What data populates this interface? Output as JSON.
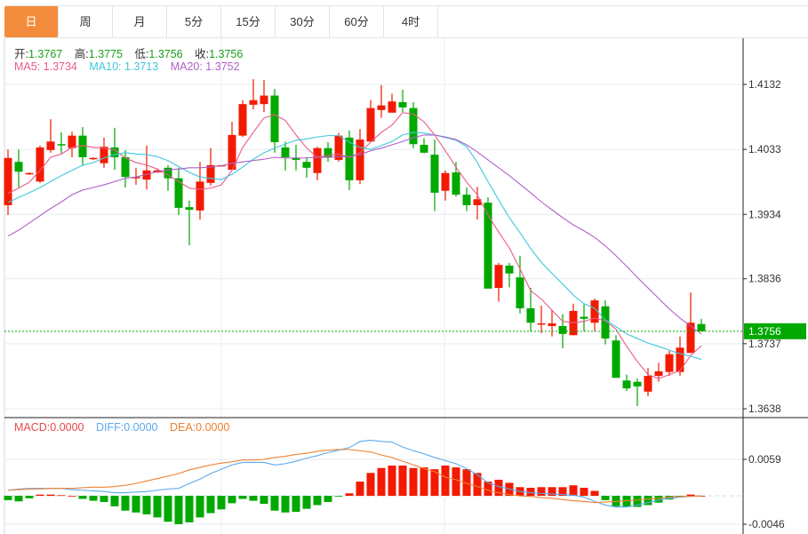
{
  "tabs": [
    {
      "label": "日",
      "active": true
    },
    {
      "label": "周"
    },
    {
      "label": "月"
    },
    {
      "label": "5分"
    },
    {
      "label": "15分"
    },
    {
      "label": "30分"
    },
    {
      "label": "60分"
    },
    {
      "label": "4时"
    }
  ],
  "ohlc_legend": {
    "open_label": "开:",
    "open": "1.3767",
    "high_label": "高:",
    "high": "1.3775",
    "low_label": "低:",
    "low": "1.3756",
    "close_label": "收:",
    "close": "1.3756"
  },
  "ma_legend": {
    "ma5": "MA5: 1.3734",
    "ma10": "MA10: 1.3713",
    "ma20": "MA20: 1.3752"
  },
  "macd_legend": {
    "macd": "MACD:0.0000",
    "diff": "DIFF:0.0000",
    "dea": "DEA:0.0000"
  },
  "colors": {
    "up": "#f21a00",
    "down": "#00a800",
    "ma5": "#ea5a8c",
    "ma10": "#3ec8dc",
    "ma20": "#b060c8",
    "diff": "#5aaaf0",
    "dea": "#f08030",
    "active_tab": "#f28c3c",
    "last_price": "#00a800"
  },
  "chart_data": [
    {
      "type": "candlestick",
      "price_ticks": [
        "1.4132",
        "1.4033",
        "1.3934",
        "1.3836",
        "1.3737",
        "1.3638"
      ],
      "ylim": [
        1.3638,
        1.4132
      ],
      "last_price": "1.3756",
      "grid": true,
      "candles": [
        [
          1.3948,
          1.4033,
          1.3933,
          1.402
        ],
        [
          1.4014,
          1.4033,
          1.3975,
          1.3999
        ],
        [
          1.3995,
          1.3998,
          1.3994,
          1.3997
        ],
        [
          1.3984,
          1.4039,
          1.3982,
          1.4036
        ],
        [
          1.4032,
          1.4079,
          1.4028,
          1.4045
        ],
        [
          1.4041,
          1.4059,
          1.4027,
          1.404
        ],
        [
          1.4035,
          1.406,
          1.4021,
          1.4054
        ],
        [
          1.4054,
          1.4067,
          1.4008,
          1.4021
        ],
        [
          1.4018,
          1.4021,
          1.4017,
          1.402
        ],
        [
          1.4012,
          1.4051,
          1.4005,
          1.4037
        ],
        [
          1.4036,
          1.4066,
          1.4002,
          1.4021
        ],
        [
          1.4021,
          1.4032,
          1.3975,
          1.3991
        ],
        [
          1.399,
          1.4005,
          1.3979,
          1.3991
        ],
        [
          1.3987,
          1.4039,
          1.3972,
          1.4001
        ],
        [
          1.3998,
          1.4004,
          1.3997,
          1.4001
        ],
        [
          1.4005,
          1.4009,
          1.397,
          1.3989
        ],
        [
          1.3989,
          1.4005,
          1.3933,
          1.3944
        ],
        [
          1.3945,
          1.3955,
          1.3887,
          1.3941
        ],
        [
          1.394,
          1.4014,
          1.3926,
          1.3984
        ],
        [
          1.3982,
          1.4035,
          1.3978,
          1.4009
        ],
        [
          1.4008,
          1.4009,
          1.4008,
          1.4009
        ],
        [
          1.4002,
          1.4075,
          1.4001,
          1.4055
        ],
        [
          1.4054,
          1.4108,
          1.4052,
          1.4102
        ],
        [
          1.4101,
          1.414,
          1.4094,
          1.4108
        ],
        [
          1.4102,
          1.4139,
          1.409,
          1.4115
        ],
        [
          1.4115,
          1.4125,
          1.4028,
          1.4044
        ],
        [
          1.4036,
          1.4045,
          1.4001,
          1.4021
        ],
        [
          1.402,
          1.404,
          1.4001,
          1.4017
        ],
        [
          1.4014,
          1.4021,
          1.399,
          1.4005
        ],
        [
          1.3997,
          1.4037,
          1.3986,
          1.4035
        ],
        [
          1.4035,
          1.4044,
          1.4014,
          1.4021
        ],
        [
          1.4017,
          1.4058,
          1.4014,
          1.4054
        ],
        [
          1.4051,
          1.4062,
          1.3971,
          1.3986
        ],
        [
          1.3986,
          1.4064,
          1.398,
          1.4048
        ],
        [
          1.4045,
          1.4108,
          1.4044,
          1.4096
        ],
        [
          1.4093,
          1.4131,
          1.4081,
          1.41
        ],
        [
          1.4089,
          1.4118,
          1.4089,
          1.4106
        ],
        [
          1.4105,
          1.4124,
          1.409,
          1.4097
        ],
        [
          1.4096,
          1.4105,
          1.4035,
          1.4041
        ],
        [
          1.404,
          1.405,
          1.4027,
          1.4028
        ],
        [
          1.4025,
          1.4048,
          1.3939,
          1.3967
        ],
        [
          1.397,
          1.4001,
          1.3955,
          1.3997
        ],
        [
          1.3998,
          1.4014,
          1.3961,
          1.3964
        ],
        [
          1.3964,
          1.3975,
          1.3939,
          1.3948
        ],
        [
          1.3948,
          1.3976,
          1.3926,
          1.3957
        ],
        [
          1.3952,
          1.396,
          1.3821,
          1.3821
        ],
        [
          1.3822,
          1.386,
          1.3801,
          1.3857
        ],
        [
          1.3856,
          1.386,
          1.3823,
          1.3844
        ],
        [
          1.3838,
          1.3871,
          1.3783,
          1.3791
        ],
        [
          1.3791,
          1.3822,
          1.3756,
          1.3769
        ],
        [
          1.3767,
          1.3795,
          1.3753,
          1.3768
        ],
        [
          1.3764,
          1.3788,
          1.3748,
          1.3768
        ],
        [
          1.3764,
          1.3782,
          1.373,
          1.3752
        ],
        [
          1.375,
          1.3798,
          1.375,
          1.3787
        ],
        [
          1.3778,
          1.3797,
          1.3756,
          1.3775
        ],
        [
          1.3769,
          1.3806,
          1.3756,
          1.3803
        ],
        [
          1.3794,
          1.3803,
          1.3736,
          1.3745
        ],
        [
          1.3742,
          1.375,
          1.3685,
          1.3685
        ],
        [
          1.3681,
          1.369,
          1.3665,
          1.3669
        ],
        [
          1.3679,
          1.3684,
          1.3642,
          1.3672
        ],
        [
          1.3664,
          1.37,
          1.3657,
          1.3688
        ],
        [
          1.3688,
          1.3708,
          1.3679,
          1.3695
        ],
        [
          1.3694,
          1.3726,
          1.3688,
          1.3721
        ],
        [
          1.3694,
          1.3748,
          1.3688,
          1.3731
        ],
        [
          1.3723,
          1.3815,
          1.3723,
          1.3769
        ],
        [
          1.3767,
          1.3775,
          1.3756,
          1.3756
        ]
      ],
      "ma5": [
        1.3966,
        1.3974,
        1.3983,
        1.4001,
        1.4021,
        1.4026,
        1.4036,
        1.4039,
        1.4036,
        1.4035,
        1.4032,
        1.402,
        1.4013,
        1.4009,
        1.4003,
        1.3994,
        1.3984,
        1.3974,
        1.3972,
        1.3974,
        1.3979,
        1.4001,
        1.4036,
        1.4059,
        1.4081,
        1.4086,
        1.4077,
        1.4055,
        1.4035,
        1.4021,
        1.4024,
        1.4026,
        1.4021,
        1.4028,
        1.4044,
        1.4059,
        1.407,
        1.4089,
        1.4087,
        1.4075,
        1.4055,
        1.4031,
        1.4006,
        1.3983,
        1.3964,
        1.3933,
        1.3907,
        1.3883,
        1.3851,
        1.3818,
        1.3805,
        1.3788,
        1.3771,
        1.3769,
        1.3771,
        1.3776,
        1.3772,
        1.3759,
        1.3733,
        1.371,
        1.369,
        1.3684,
        1.369,
        1.3696,
        1.3719,
        1.3734
      ],
      "ma10": [
        1.3952,
        1.396,
        1.3967,
        1.3975,
        1.3984,
        1.3993,
        1.4001,
        1.4009,
        1.4013,
        1.402,
        1.4025,
        1.4028,
        1.4026,
        1.4025,
        1.4022,
        1.4016,
        1.4007,
        1.3998,
        1.3991,
        1.3989,
        1.3987,
        1.3995,
        1.4006,
        1.4018,
        1.4028,
        1.4035,
        1.4041,
        1.4047,
        1.4049,
        1.4052,
        1.4054,
        1.4054,
        1.4044,
        1.4036,
        1.4033,
        1.4039,
        1.4045,
        1.4055,
        1.4059,
        1.4058,
        1.4055,
        1.4051,
        1.4047,
        1.4037,
        1.4013,
        1.3984,
        1.3956,
        1.3929,
        1.3906,
        1.3882,
        1.3861,
        1.3844,
        1.3828,
        1.3811,
        1.3798,
        1.3791,
        1.3773,
        1.3763,
        1.3752,
        1.3745,
        1.3738,
        1.3733,
        1.3727,
        1.3722,
        1.3718,
        1.3713
      ],
      "ma20": [
        1.3901,
        1.391,
        1.3921,
        1.3932,
        1.3943,
        1.3953,
        1.3964,
        1.3971,
        1.3975,
        1.3979,
        1.3984,
        1.3989,
        1.3991,
        1.3995,
        1.3999,
        1.4002,
        1.4003,
        1.4005,
        1.4005,
        1.4006,
        1.4008,
        1.4012,
        1.4014,
        1.4016,
        1.4018,
        1.4021,
        1.402,
        1.402,
        1.402,
        1.4021,
        1.4021,
        1.4022,
        1.4022,
        1.4025,
        1.4031,
        1.4035,
        1.404,
        1.4045,
        1.4051,
        1.4055,
        1.4055,
        1.4052,
        1.4048,
        1.404,
        1.4029,
        1.4017,
        1.4005,
        1.3993,
        1.398,
        1.3967,
        1.3953,
        1.3941,
        1.3929,
        1.3918,
        1.3909,
        1.3899,
        1.3886,
        1.3871,
        1.3855,
        1.3838,
        1.3822,
        1.3806,
        1.379,
        1.3776,
        1.3764,
        1.3752
      ]
    },
    {
      "type": "bar+line",
      "ticks": [
        "0.0059",
        "-0.0046"
      ],
      "ylim": [
        -0.0046,
        0.0059
      ],
      "macd": [
        -0.0007,
        -0.0009,
        -0.0004,
        0.0002,
        0.0002,
        0.0001,
        0.0,
        -0.0005,
        -0.0008,
        -0.001,
        -0.0017,
        -0.0024,
        -0.0027,
        -0.003,
        -0.0035,
        -0.0042,
        -0.0046,
        -0.0043,
        -0.0035,
        -0.0028,
        -0.0022,
        -0.0012,
        -0.0005,
        -0.0008,
        -0.0013,
        -0.0024,
        -0.0027,
        -0.0026,
        -0.0021,
        -0.0015,
        -0.001,
        -0.0001,
        0.0004,
        0.0023,
        0.0037,
        0.0045,
        0.0049,
        0.0049,
        0.0045,
        0.0046,
        0.0043,
        0.0049,
        0.0046,
        0.0043,
        0.0037,
        0.0023,
        0.0026,
        0.0021,
        0.0014,
        0.0013,
        0.0014,
        0.0014,
        0.0014,
        0.0017,
        0.0013,
        0.0008,
        -0.0007,
        -0.0017,
        -0.0018,
        -0.0018,
        -0.0015,
        -0.0011,
        -0.0006,
        -0.0002,
        0.0002,
        0.0
      ],
      "diff": [
        0.0009,
        0.0011,
        0.0012,
        0.0012,
        0.0012,
        0.0012,
        0.001,
        0.0009,
        0.0008,
        0.0007,
        0.0005,
        0.0005,
        0.0006,
        0.0007,
        0.0009,
        0.0011,
        0.0012,
        0.002,
        0.0027,
        0.0036,
        0.0043,
        0.005,
        0.0054,
        0.0054,
        0.0054,
        0.005,
        0.0052,
        0.0056,
        0.0061,
        0.0065,
        0.007,
        0.0074,
        0.0078,
        0.0088,
        0.009,
        0.0088,
        0.0087,
        0.0079,
        0.0073,
        0.0068,
        0.0062,
        0.0057,
        0.0052,
        0.0044,
        0.0034,
        0.0021,
        0.0015,
        0.0011,
        0.0007,
        0.0005,
        0.0004,
        0.0003,
        0.0002,
        0.0001,
        -0.0002,
        -0.0009,
        -0.0015,
        -0.0018,
        -0.0018,
        -0.0015,
        -0.0011,
        -0.0007,
        -0.0004,
        -0.0002,
        -0.0001,
        0.0
      ],
      "dea": [
        0.0009,
        0.001,
        0.0011,
        0.0011,
        0.0012,
        0.0012,
        0.0012,
        0.0013,
        0.0014,
        0.0014,
        0.0015,
        0.0017,
        0.002,
        0.0024,
        0.0028,
        0.0032,
        0.0036,
        0.0042,
        0.0046,
        0.005,
        0.0053,
        0.0055,
        0.0058,
        0.0058,
        0.0059,
        0.0062,
        0.0064,
        0.0067,
        0.0069,
        0.0072,
        0.0074,
        0.0075,
        0.0075,
        0.0073,
        0.0071,
        0.0066,
        0.0062,
        0.0056,
        0.005,
        0.0044,
        0.0039,
        0.003,
        0.0026,
        0.002,
        0.0015,
        0.0009,
        0.0005,
        0.0002,
        0.0,
        -0.0001,
        -0.0003,
        -0.0004,
        -0.0006,
        -0.0008,
        -0.0009,
        -0.0011,
        -0.001,
        -0.0009,
        -0.0008,
        -0.0007,
        -0.0005,
        -0.0004,
        -0.0002,
        -0.0001,
        -0.0001,
        0.0
      ]
    }
  ]
}
